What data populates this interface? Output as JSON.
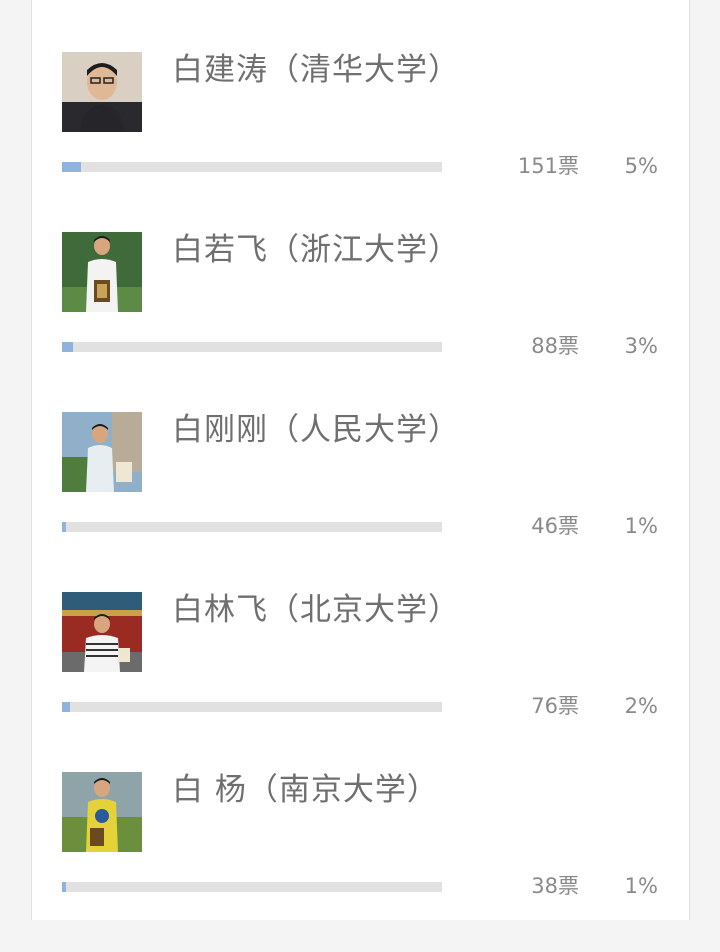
{
  "candidates": [
    {
      "name": "白建涛（清华大学）",
      "votes_label": "151票",
      "percent_label": "5%",
      "share": 0.05,
      "avatar_icon": "person-avatar-icon"
    },
    {
      "name": "白若飞（浙江大学）",
      "votes_label": "88票",
      "percent_label": "3%",
      "share": 0.03,
      "avatar_icon": "person-avatar-icon"
    },
    {
      "name": "白刚刚（人民大学）",
      "votes_label": "46票",
      "percent_label": "1%",
      "share": 0.01,
      "avatar_icon": "person-avatar-icon"
    },
    {
      "name": "白林飞（北京大学）",
      "votes_label": "76票",
      "percent_label": "2%",
      "share": 0.02,
      "avatar_icon": "person-avatar-icon"
    },
    {
      "name": "白 杨（南京大学）",
      "votes_label": "38票",
      "percent_label": "1%",
      "share": 0.01,
      "avatar_icon": "person-avatar-icon"
    }
  ],
  "colors": {
    "bar_fill": "#8fb3dd",
    "bar_track": "#e1e1e1",
    "text": "#6f6f6f",
    "meta_text": "#8a8a8a"
  }
}
